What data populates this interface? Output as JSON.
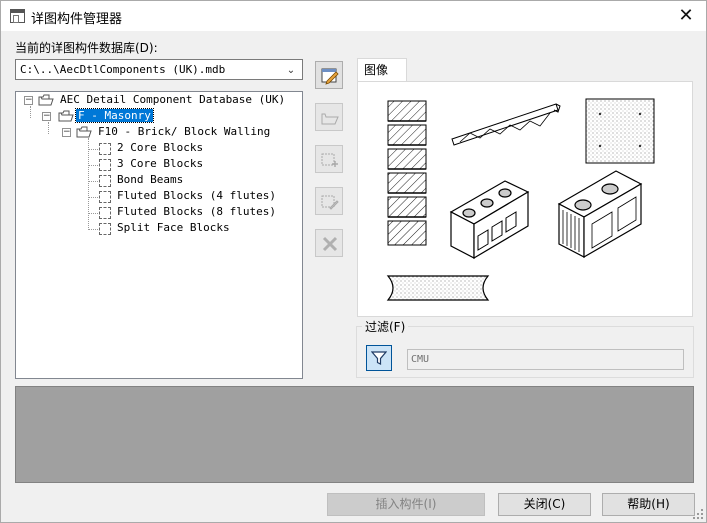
{
  "window": {
    "title": "详图构件管理器",
    "close_glyph": "✕"
  },
  "database": {
    "label": "当前的详图构件数据库(D):",
    "value": "C:\\..\\AecDtlComponents (UK).mdb"
  },
  "tree": {
    "root": "AEC Detail Component Database (UK)",
    "division": "F - Masonry",
    "section": "F10 - Brick/ Block Walling",
    "items": [
      "2 Core Blocks",
      "3 Core Blocks",
      "Bond Beams",
      "Fluted Blocks (4 flutes)",
      "Fluted Blocks (8 flutes)",
      "Split Face Blocks"
    ]
  },
  "side_buttons": [
    {
      "icon": "edit-database-icon",
      "enabled": true
    },
    {
      "icon": "open-folder-icon",
      "enabled": false
    },
    {
      "icon": "add-component-icon",
      "enabled": false
    },
    {
      "icon": "edit-component-icon",
      "enabled": false
    },
    {
      "icon": "delete-icon",
      "enabled": false
    }
  ],
  "preview": {
    "tab_label": "图像"
  },
  "filter": {
    "label": "过滤(F)",
    "value": "CMU",
    "icon": "funnel-icon"
  },
  "buttons": {
    "insert": "插入构件(I)",
    "close": "关闭(C)",
    "help": "帮助(H)"
  }
}
